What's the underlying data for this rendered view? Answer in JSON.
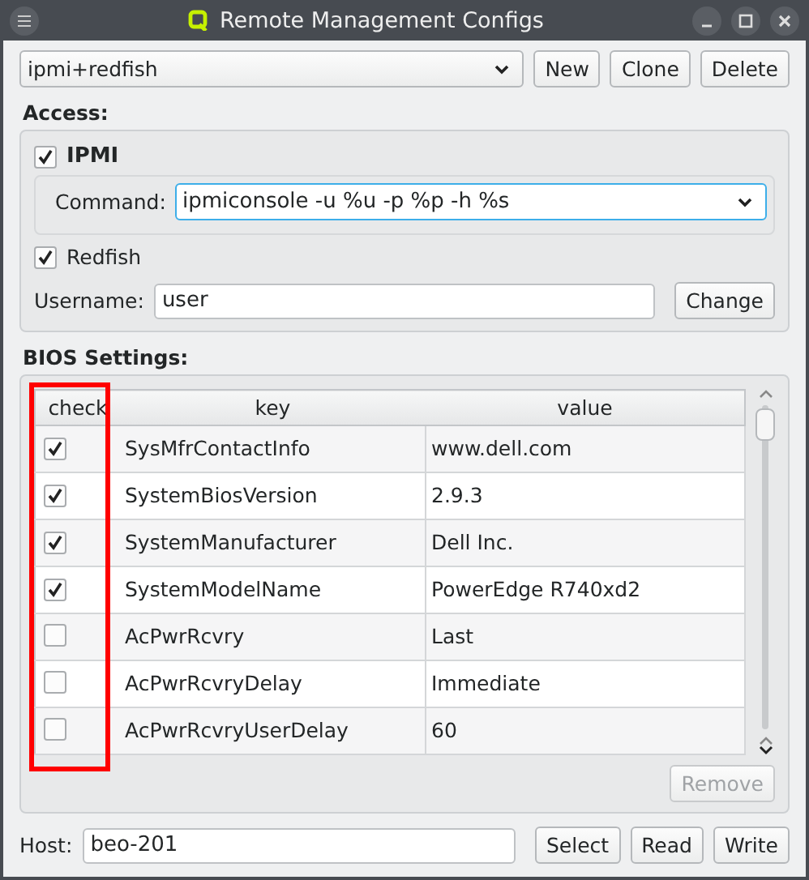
{
  "window": {
    "title": "Remote Management Configs"
  },
  "config": {
    "value": "ipmi+redfish",
    "buttons": [
      "New",
      "Clone",
      "Delete"
    ]
  },
  "access": {
    "title": "Access:",
    "ipmi": {
      "label": "IPMI",
      "checked": true,
      "command_label": "Command:",
      "command": "ipmiconsole -u %u -p %p -h %s"
    },
    "redfish": {
      "label": "Redfish",
      "checked": true
    },
    "username_label": "Username:",
    "username": "user",
    "change_button": "Change"
  },
  "bios": {
    "title": "BIOS Settings:",
    "highlight_check_column": true,
    "columns": [
      "check",
      "key",
      "value"
    ],
    "rows": [
      {
        "checked": true,
        "key": "SysMfrContactInfo",
        "value": "www.dell.com"
      },
      {
        "checked": true,
        "key": "SystemBiosVersion",
        "value": "2.9.3"
      },
      {
        "checked": true,
        "key": "SystemManufacturer",
        "value": "Dell Inc."
      },
      {
        "checked": true,
        "key": "SystemModelName",
        "value": "PowerEdge R740xd2"
      },
      {
        "checked": false,
        "key": "AcPwrRcvry",
        "value": "Last"
      },
      {
        "checked": false,
        "key": "AcPwrRcvryDelay",
        "value": "Immediate"
      },
      {
        "checked": false,
        "key": "AcPwrRcvryUserDelay",
        "value": "60"
      }
    ],
    "remove_button": {
      "label": "Remove",
      "disabled": true
    }
  },
  "host": {
    "label": "Host:",
    "value": "beo-201",
    "buttons": [
      "Select",
      "Read",
      "Write"
    ]
  }
}
